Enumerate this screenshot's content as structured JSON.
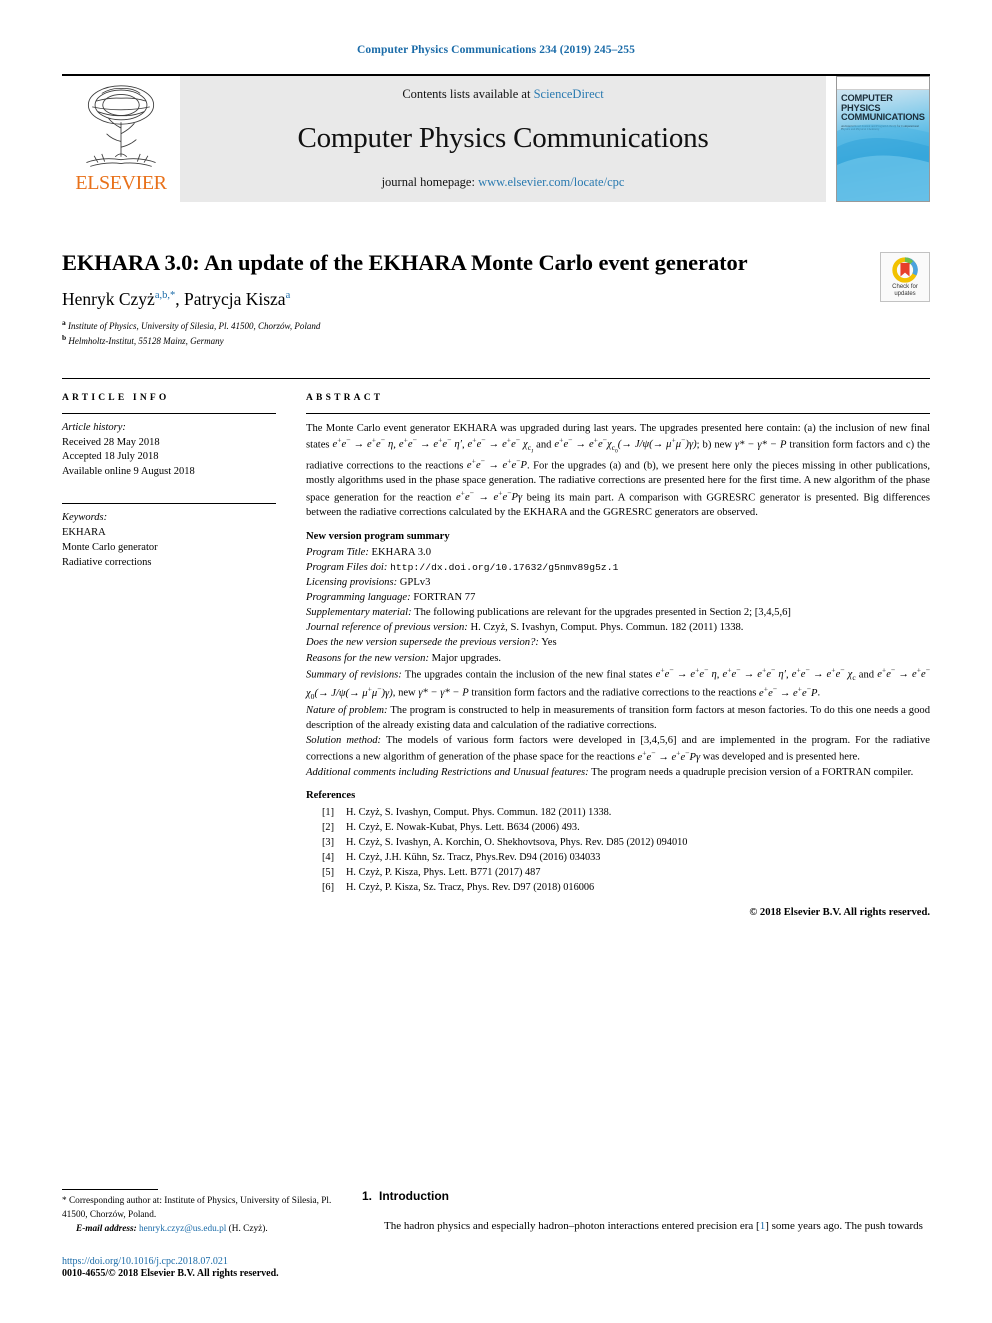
{
  "running_head": "Computer Physics Communications 234 (2019) 245–255",
  "masthead": {
    "contents_prefix": "Contents lists available at",
    "contents_link": "ScienceDirect",
    "journal_title": "Computer Physics Communications",
    "homepage_prefix": "journal homepage:",
    "homepage_link": "www.elsevier.com/locate/cpc",
    "publisher_word": "ELSEVIER",
    "cover_title_line1": "COMPUTER PHYSICS",
    "cover_title_line2": "COMMUNICATIONS",
    "cover_subtitle": "An International Journal and Program Library for Computational Physics and Physical Chemistry"
  },
  "title_block": {
    "title": "EKHARA 3.0: An update of the EKHARA Monte Carlo event generator",
    "author1": "Henryk Czyż",
    "author1_marks": "a,b,*",
    "author2": "Patrycja Kisza",
    "author2_marks": "a",
    "affiliation_a_mark": "a",
    "affiliation_a": "Institute of Physics, University of Silesia, Pl. 41500, Chorzów, Poland",
    "affiliation_b_mark": "b",
    "affiliation_b": "Helmholtz-Institut, 55128 Mainz, Germany",
    "crossmark_line1": "Check for",
    "crossmark_line2": "updates"
  },
  "article_info": {
    "heading": "ARTICLE INFO",
    "history_label": "Article history:",
    "received": "Received 28 May 2018",
    "accepted": "Accepted 18 July 2018",
    "available": "Available online 9 August 2018",
    "keywords_label": "Keywords:",
    "keywords": [
      "EKHARA",
      "Monte Carlo generator",
      "Radiative corrections"
    ]
  },
  "abstract": {
    "heading": "ABSTRACT",
    "para1_a": "The Monte Carlo event generator EKHARA was upgraded during last years. The upgrades presented here contain: (a) the inclusion of new final states",
    "para1_b": "; b) new",
    "para1_c": "transition form factors and c) the radiative corrections to the reactions",
    "para1_d": ". For the upgrades (a) and (b), we present here only the pieces missing in other publications, mostly algorithms used in the phase space generation. The radiative corrections are presented here for the first time. A new algorithm of the phase space generation for the reaction",
    "para1_e": "being its main part. A comparison with GGRESRC generator is presented. Big differences between the radiative corrections calculated by the EKHARA and the GGRESRC generators are observed."
  },
  "summary": {
    "heading": "New version program summary",
    "program_title_label": "Program Title:",
    "program_title_value": "EKHARA 3.0",
    "files_doi_label": "Program Files doi:",
    "files_doi_value": "http://dx.doi.org/10.17632/g5nmv89g5z.1",
    "licensing_label": "Licensing provisions:",
    "licensing_value": "GPLv3",
    "language_label": "Programming language:",
    "language_value": "FORTRAN 77",
    "supplementary_label": "Supplementary material:",
    "supplementary_value": "The following publications are relevant for the upgrades presented in Section 2; [3,4,5,6]",
    "journal_ref_label": "Journal reference of previous version:",
    "journal_ref_value": "H. Czyż, S. Ivashyn, Comput. Phys. Commun. 182 (2011) 1338.",
    "supersede_label": "Does the new version supersede the previous version?:",
    "supersede_value": "Yes",
    "reasons_label": "Reasons for the new version:",
    "reasons_value": "Major upgrades.",
    "revisions_label": "Summary of revisions:",
    "revisions_a": "The upgrades contain the inclusion of the new final states",
    "revisions_b": "transition form factors and the radiative corrections to the reactions",
    "nature_label": "Nature of problem:",
    "nature_value": "The program is constructed to help in measurements of transition form factors at meson factories. To do this one needs a good description of the already existing data and calculation of the radiative corrections.",
    "solution_label": "Solution method:",
    "solution_a": "The models of various form factors were developed in [3,4,5,6] and are implemented in the program. For the radiative corrections a new algorithm of generation of the phase space for the reactions",
    "solution_b": "was developed and is presented here.",
    "additional_label": "Additional comments including Restrictions and Unusual features:",
    "additional_value": "The program needs a quadruple precision version of a FORTRAN compiler."
  },
  "references": {
    "heading": "References",
    "items": [
      {
        "num": "[1]",
        "text": "H. Czyż, S. Ivashyn, Comput. Phys. Commun. 182 (2011) 1338."
      },
      {
        "num": "[2]",
        "text": "H. Czyż, E. Nowak-Kubat, Phys. Lett. B634 (2006) 493."
      },
      {
        "num": "[3]",
        "text": "H. Czyż, S. Ivashyn, A. Korchin, O. Shekhovtsova, Phys. Rev. D85 (2012) 094010"
      },
      {
        "num": "[4]",
        "text": "H. Czyż, J.H. Kühn, Sz. Tracz, Phys.Rev. D94 (2016) 034033"
      },
      {
        "num": "[5]",
        "text": "H. Czyż, P. Kisza, Phys. Lett. B771 (2017) 487"
      },
      {
        "num": "[6]",
        "text": "H. Czyż, P. Kisza, Sz. Tracz, Phys. Rev. D97 (2018) 016006"
      }
    ],
    "copyright": "© 2018 Elsevier B.V. All rights reserved."
  },
  "footer": {
    "corresponding": "* Corresponding author at: Institute of Physics, University of Silesia, Pl. 41500, Chorzów, Poland.",
    "email_label": "E-mail address:",
    "email": "henryk.czyz@us.edu.pl",
    "email_suffix": "(H. Czyż).",
    "doi": "https://doi.org/10.1016/j.cpc.2018.07.021",
    "issn": "0010-4655/© 2018 Elsevier B.V. All rights reserved."
  },
  "introduction": {
    "number": "1.",
    "heading": "Introduction",
    "para_a": "The hadron physics and especially hadron–photon interactions entered precision era [",
    "ref_link": "1",
    "para_b": "] some years ago. The push towards"
  },
  "colors": {
    "link": "#1a6ba8",
    "elsevier_orange": "#e8711a",
    "masthead_bg": "#e9e9e9"
  }
}
